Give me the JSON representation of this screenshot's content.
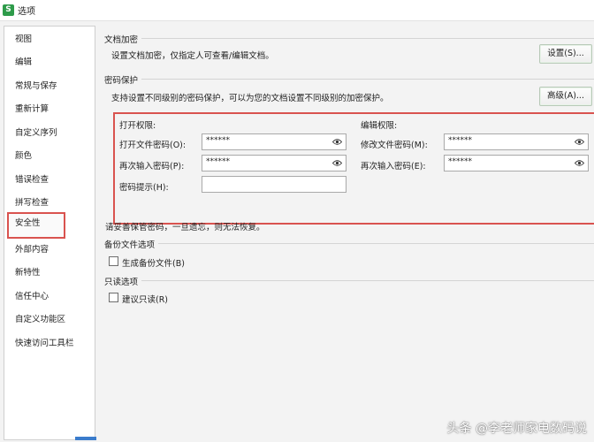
{
  "window": {
    "app_icon": "S",
    "title": "选项"
  },
  "sidebar": {
    "items": [
      {
        "label": "视图"
      },
      {
        "label": "编辑"
      },
      {
        "label": "常规与保存"
      },
      {
        "label": "重新计算"
      },
      {
        "label": "自定义序列"
      },
      {
        "label": "颜色"
      },
      {
        "label": "错误检查"
      },
      {
        "label": "拼写检查"
      },
      {
        "label": "安全性",
        "active": true
      },
      {
        "label": "外部内容"
      },
      {
        "label": "新特性"
      },
      {
        "label": "信任中心"
      },
      {
        "label": "自定义功能区"
      },
      {
        "label": "快速访问工具栏"
      }
    ]
  },
  "encrypt": {
    "title": "文档加密",
    "desc": "设置文档加密，仅指定人可查看/编辑文档。",
    "button": "设置(S)..."
  },
  "protect": {
    "title": "密码保护",
    "desc": "支持设置不同级别的密码保护，可以为您的文档设置不同级别的加密保护。",
    "button": "高级(A)...",
    "open_perm": {
      "title": "打开权限:",
      "password_label": "打开文件密码(O):",
      "password_value": "******",
      "confirm_label": "再次输入密码(P):",
      "confirm_value": "******",
      "hint_label": "密码提示(H):",
      "hint_value": ""
    },
    "edit_perm": {
      "title": "编辑权限:",
      "password_label": "修改文件密码(M):",
      "password_value": "******",
      "confirm_label": "再次输入密码(E):",
      "confirm_value": "******"
    },
    "note": "请妥善保管密码，一旦遗忘，则无法恢复。"
  },
  "backup": {
    "title": "备份文件选项",
    "checkbox_label": "生成备份文件(B)",
    "checked": false
  },
  "readonly": {
    "title": "只读选项",
    "checkbox_label": "建议只读(R)",
    "checked": false
  },
  "watermark": "头条 @李老师家电数码说",
  "colors": {
    "highlight_border": "#d9534f",
    "app_icon_bg": "#2e9b4a"
  }
}
